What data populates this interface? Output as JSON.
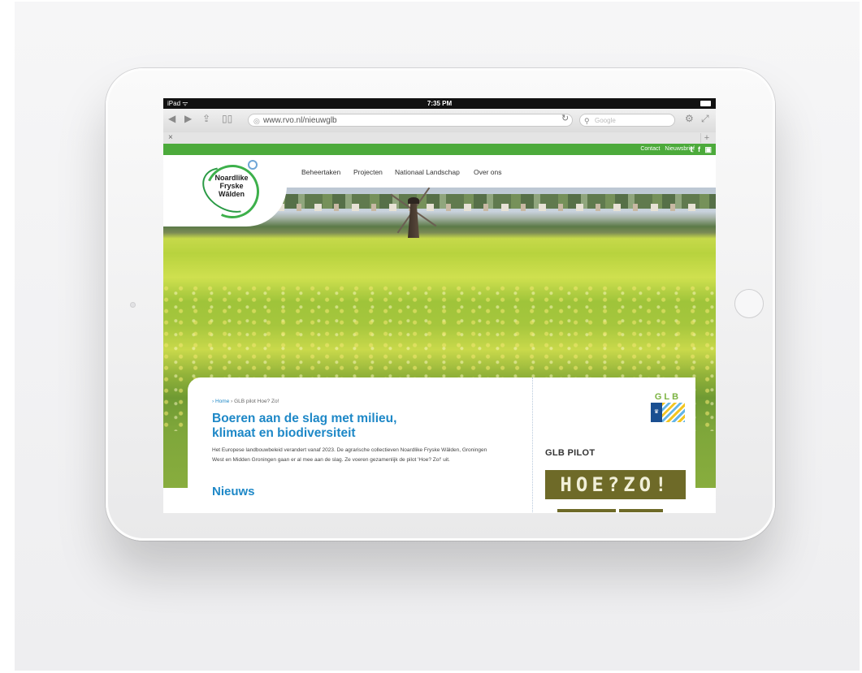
{
  "device": {
    "status_left": "iPad ᯤ",
    "time": "7:35 PM"
  },
  "browser": {
    "url": "www.rvo.nl/nieuwglb",
    "search_placeholder": "Google",
    "tab_close": "×",
    "tab_add": "+"
  },
  "site": {
    "top_links": [
      "Contact",
      "Nieuwsbrief"
    ],
    "social": [
      "twitter-icon",
      "facebook-icon",
      "youtube-icon"
    ],
    "logo_text": [
      "Noardlike",
      "Fryske",
      "Wâlden"
    ],
    "nav": [
      "Beheertaken",
      "Projecten",
      "Nationaal Landschap",
      "Over ons"
    ],
    "breadcrumb_home": "› Home",
    "breadcrumb_rest": " › GLB pilot Hoe? Zo!",
    "headline_1": "Boeren aan de slag met milieu,",
    "headline_2": "klimaat en biodiversiteit",
    "intro": "Het Europese landbouwbeleid verandert vanaf 2023. De agrarische collectieven Noardlike Fryske Wâlden, Groningen West en Midden Groningen gaan er al mee aan de slag. Ze voeren gezamenlijk de pilot 'Hoe? Zo!' uit.",
    "news_title": "Nieuws"
  },
  "sidebar": {
    "glb_logo_text": "GLB",
    "glb_pilot": "GLB PILOT",
    "hoezo": "HOE?ZO!"
  },
  "colors": {
    "green_bar": "#4caa3b",
    "heading_blue": "#1e88c7",
    "hoezo_bg": "#6e6a28"
  }
}
